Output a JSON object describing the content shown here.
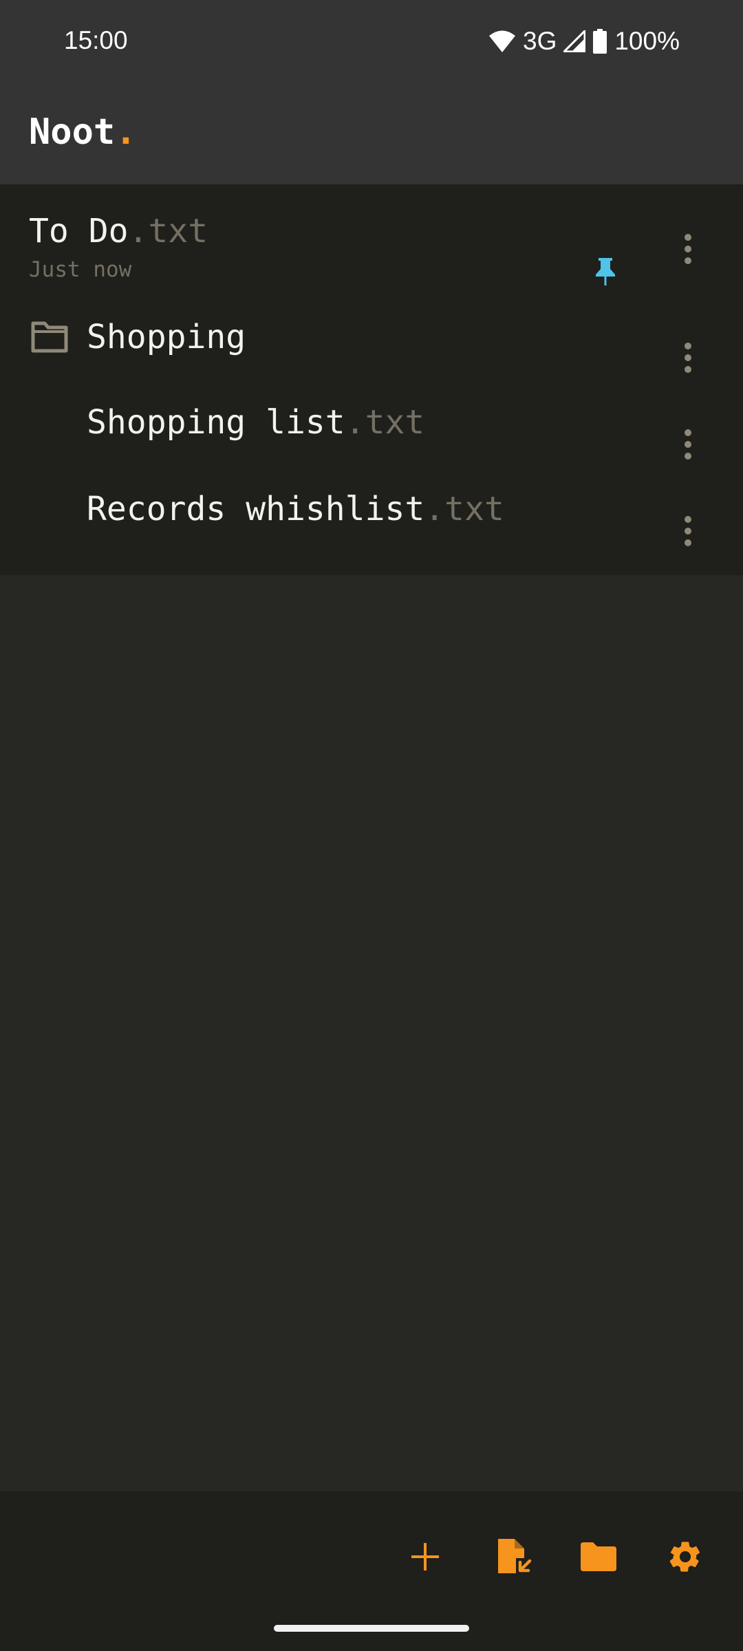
{
  "status_bar": {
    "time": "15:00",
    "network": "3G",
    "battery": "100%",
    "icons": [
      "wifi-icon",
      "cell-signal-icon",
      "battery-icon"
    ]
  },
  "app_bar": {
    "title": "Noot",
    "title_dot": "."
  },
  "files": [
    {
      "type": "file",
      "name": "To Do",
      "ext": ".txt",
      "modified": "Just now",
      "pinned": true
    },
    {
      "type": "folder",
      "name": "Shopping"
    },
    {
      "type": "file",
      "name": "Shopping list",
      "ext": ".txt",
      "in_folder": "Shopping"
    },
    {
      "type": "file",
      "name": "Records whishlist",
      "ext": ".txt",
      "in_folder": "Shopping"
    }
  ],
  "toolbar": {
    "actions": [
      "add-icon",
      "import-file-icon",
      "folder-icon",
      "settings-icon"
    ]
  },
  "colors": {
    "accent": "#f7941d",
    "pin": "#4fc3e8",
    "muted_text": "#747062",
    "bar_bg": "#343434",
    "list_bg": "#1f1f1c",
    "page_bg": "#272824"
  }
}
